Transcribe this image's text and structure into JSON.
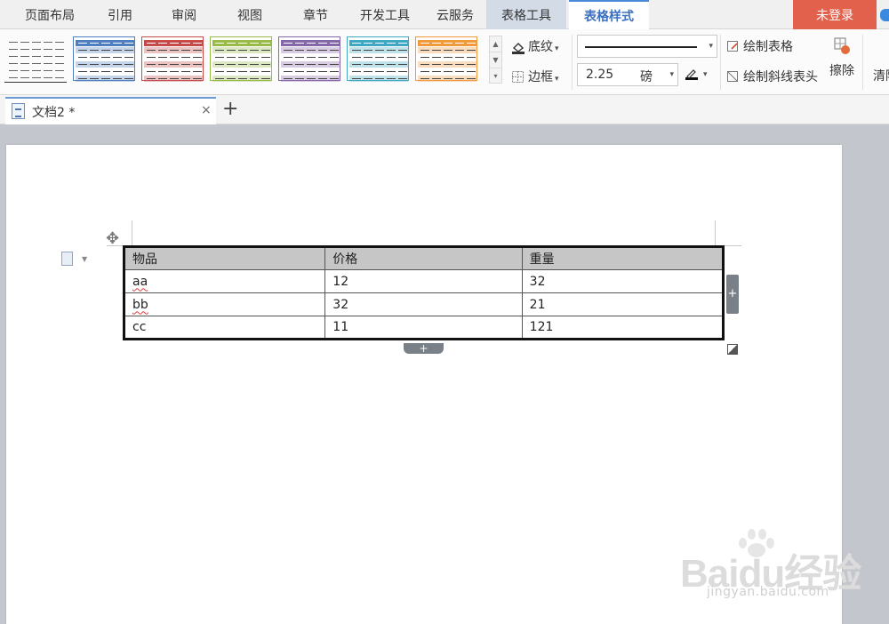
{
  "menu": {
    "tabs": [
      {
        "label": "页面布局"
      },
      {
        "label": "引用"
      },
      {
        "label": "审阅"
      },
      {
        "label": "视图"
      },
      {
        "label": "章节"
      },
      {
        "label": "开发工具"
      },
      {
        "label": "云服务"
      },
      {
        "label": "表格工具"
      },
      {
        "label": "表格样式"
      }
    ],
    "login_label": "未登录"
  },
  "ribbon": {
    "style_colors": [
      "#555555",
      "#4f7fc0",
      "#c64a4a",
      "#97bb46",
      "#8667a8",
      "#3fa8c2",
      "#f19a3c"
    ],
    "shading_label": "底纹",
    "border_label": "边框",
    "line_width_value": "2.25",
    "line_width_unit": "磅",
    "draw_table_label": "绘制表格",
    "draw_diagonal_label": "绘制斜线表头",
    "erase_label": "擦除",
    "clear_label": "清除"
  },
  "document_tab": {
    "name": "文档2 *",
    "close": "×",
    "new": "+"
  },
  "table": {
    "headers": [
      "物品",
      "价格",
      "重量"
    ],
    "rows": [
      [
        "aa",
        "12",
        "32"
      ],
      [
        "bb",
        "32",
        "21"
      ],
      [
        "cc",
        "11",
        "121"
      ]
    ]
  },
  "watermark": {
    "brand": "Baidu经验",
    "url": "jingyan.baidu.com"
  }
}
